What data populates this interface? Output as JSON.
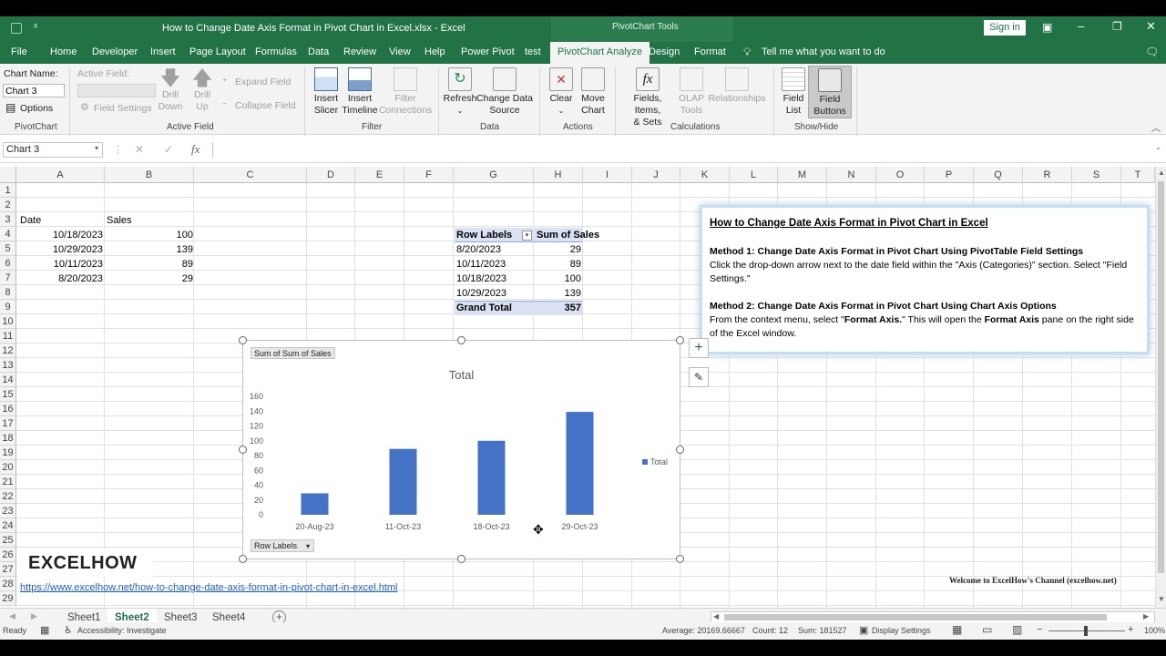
{
  "window": {
    "title": "How to Change Date Axis Format in Pivot Chart in Excel.xlsx  -  Excel",
    "context_tools": "PivotChart Tools",
    "sign_in": "Sign in"
  },
  "tabs": [
    "File",
    "Home",
    "Developer",
    "Insert",
    "Page Layout",
    "Formulas",
    "Data",
    "Review",
    "View",
    "Help",
    "Power Pivot",
    "test",
    "PivotChart Analyze",
    "Design",
    "Format"
  ],
  "active_tab": "PivotChart Analyze",
  "tell_me": "Tell me what you want to do",
  "ribbon": {
    "chart_name_label": "Chart Name:",
    "chart_name_value": "Chart 3",
    "options": "Options",
    "active_field_label": "Active Field:",
    "field_settings": "Field Settings",
    "drill_down": [
      "Drill",
      "Down"
    ],
    "drill_up": [
      "Drill",
      "Up"
    ],
    "expand_field": "Expand Field",
    "collapse_field": "Collapse Field",
    "insert_slicer": [
      "Insert",
      "Slicer"
    ],
    "insert_timeline": [
      "Insert",
      "Timeline"
    ],
    "filter_connections": [
      "Filter",
      "Connections"
    ],
    "refresh": "Refresh",
    "change_data_source": [
      "Change Data",
      "Source"
    ],
    "clear": "Clear",
    "move_chart": [
      "Move",
      "Chart"
    ],
    "fields_items_sets": [
      "Fields, Items,",
      "& Sets"
    ],
    "olap_tools": [
      "OLAP",
      "Tools"
    ],
    "relationships": "Relationships",
    "field_list": [
      "Field",
      "List"
    ],
    "field_buttons": [
      "Field",
      "Buttons"
    ],
    "groups": {
      "pivotchart": "PivotChart",
      "active_field": "Active Field",
      "filter": "Filter",
      "data": "Data",
      "actions": "Actions",
      "calculations": "Calculations",
      "show_hide": "Show/Hide"
    }
  },
  "formula_bar": {
    "name_box": "Chart 3",
    "fx": "fx",
    "content": ""
  },
  "columns": [
    "A",
    "B",
    "C",
    "D",
    "E",
    "F",
    "G",
    "H",
    "I",
    "J",
    "K",
    "L",
    "M",
    "N",
    "O",
    "P",
    "Q",
    "R",
    "S",
    "T"
  ],
  "rows": [
    "1",
    "2",
    "3",
    "4",
    "5",
    "6",
    "7",
    "8",
    "9",
    "10",
    "11",
    "12",
    "13",
    "14",
    "15",
    "16",
    "17",
    "18",
    "19",
    "20",
    "21",
    "22",
    "23",
    "24",
    "25",
    "26",
    "27",
    "28",
    "29"
  ],
  "sheet": {
    "header_date": "Date",
    "header_sales": "Sales",
    "records": [
      {
        "date": "10/18/2023",
        "sales": "100"
      },
      {
        "date": "10/29/2023",
        "sales": "139"
      },
      {
        "date": "10/11/2023",
        "sales": "89"
      },
      {
        "date": "8/20/2023",
        "sales": "29"
      }
    ],
    "link": "https://www.excelhow.net/how-to-change-date-axis-format-in-pivot-chart-in-excel.html",
    "logo": "EXCELHOW",
    "welcome": "Welcome to ExcelHow's Channel (excelhow.net)"
  },
  "pivot": {
    "row_labels": "Row Labels",
    "sum_of_sales": "Sum of Sales",
    "rows": [
      {
        "label": "8/20/2023",
        "value": "29"
      },
      {
        "label": "10/11/2023",
        "value": "89"
      },
      {
        "label": "10/18/2023",
        "value": "100"
      },
      {
        "label": "10/29/2023",
        "value": "139"
      }
    ],
    "grand_total_label": "Grand Total",
    "grand_total": "357"
  },
  "chart_data": {
    "type": "bar",
    "title": "Total",
    "value_field_button": "Sum of Sum of Sales",
    "axis_field_button": "Row Labels",
    "categories": [
      "20-Aug-23",
      "11-Oct-23",
      "18-Oct-23",
      "29-Oct-23"
    ],
    "series": [
      {
        "name": "Total",
        "values": [
          29,
          89,
          100,
          139
        ]
      }
    ],
    "ylim": [
      0,
      160
    ],
    "yticks": [
      "0",
      "20",
      "40",
      "60",
      "80",
      "100",
      "120",
      "140",
      "160"
    ],
    "legend": "right",
    "color": "#4472c4",
    "grid": false
  },
  "note": {
    "title": "How to Change Date Axis Format in Pivot Chart in Excel",
    "m1_title": "Method 1: Change Date Axis Format in Pivot Chart Using PivotTable Field Settings",
    "m1_body": "Click the drop-down arrow next to the date field within the \"Axis (Categories)\" section. Select \"Field Settings.\"",
    "m2_title": "Method 2: Change Date Axis Format in Pivot Chart Using Chart Axis Options",
    "m2_a": "From the context menu, select \"",
    "m2_b": "Format Axis.",
    "m2_c": "\" This will open the ",
    "m2_d": "Format Axis",
    "m2_e": " pane on the right side of the Excel window."
  },
  "sheet_tabs": [
    "Sheet1",
    "Sheet2",
    "Sheet3",
    "Sheet4"
  ],
  "active_sheet": "Sheet2",
  "status": {
    "ready": "Ready",
    "accessibility": "Accessibility: Investigate",
    "average": "Average: 20169.66667",
    "count": "Count: 12",
    "sum": "Sum: 181527",
    "display_settings": "Display Settings",
    "zoom": "100%"
  },
  "colors": {
    "excel_green": "#217346",
    "bar": "#4472c4",
    "pivot_header": "#d9e1f2"
  }
}
